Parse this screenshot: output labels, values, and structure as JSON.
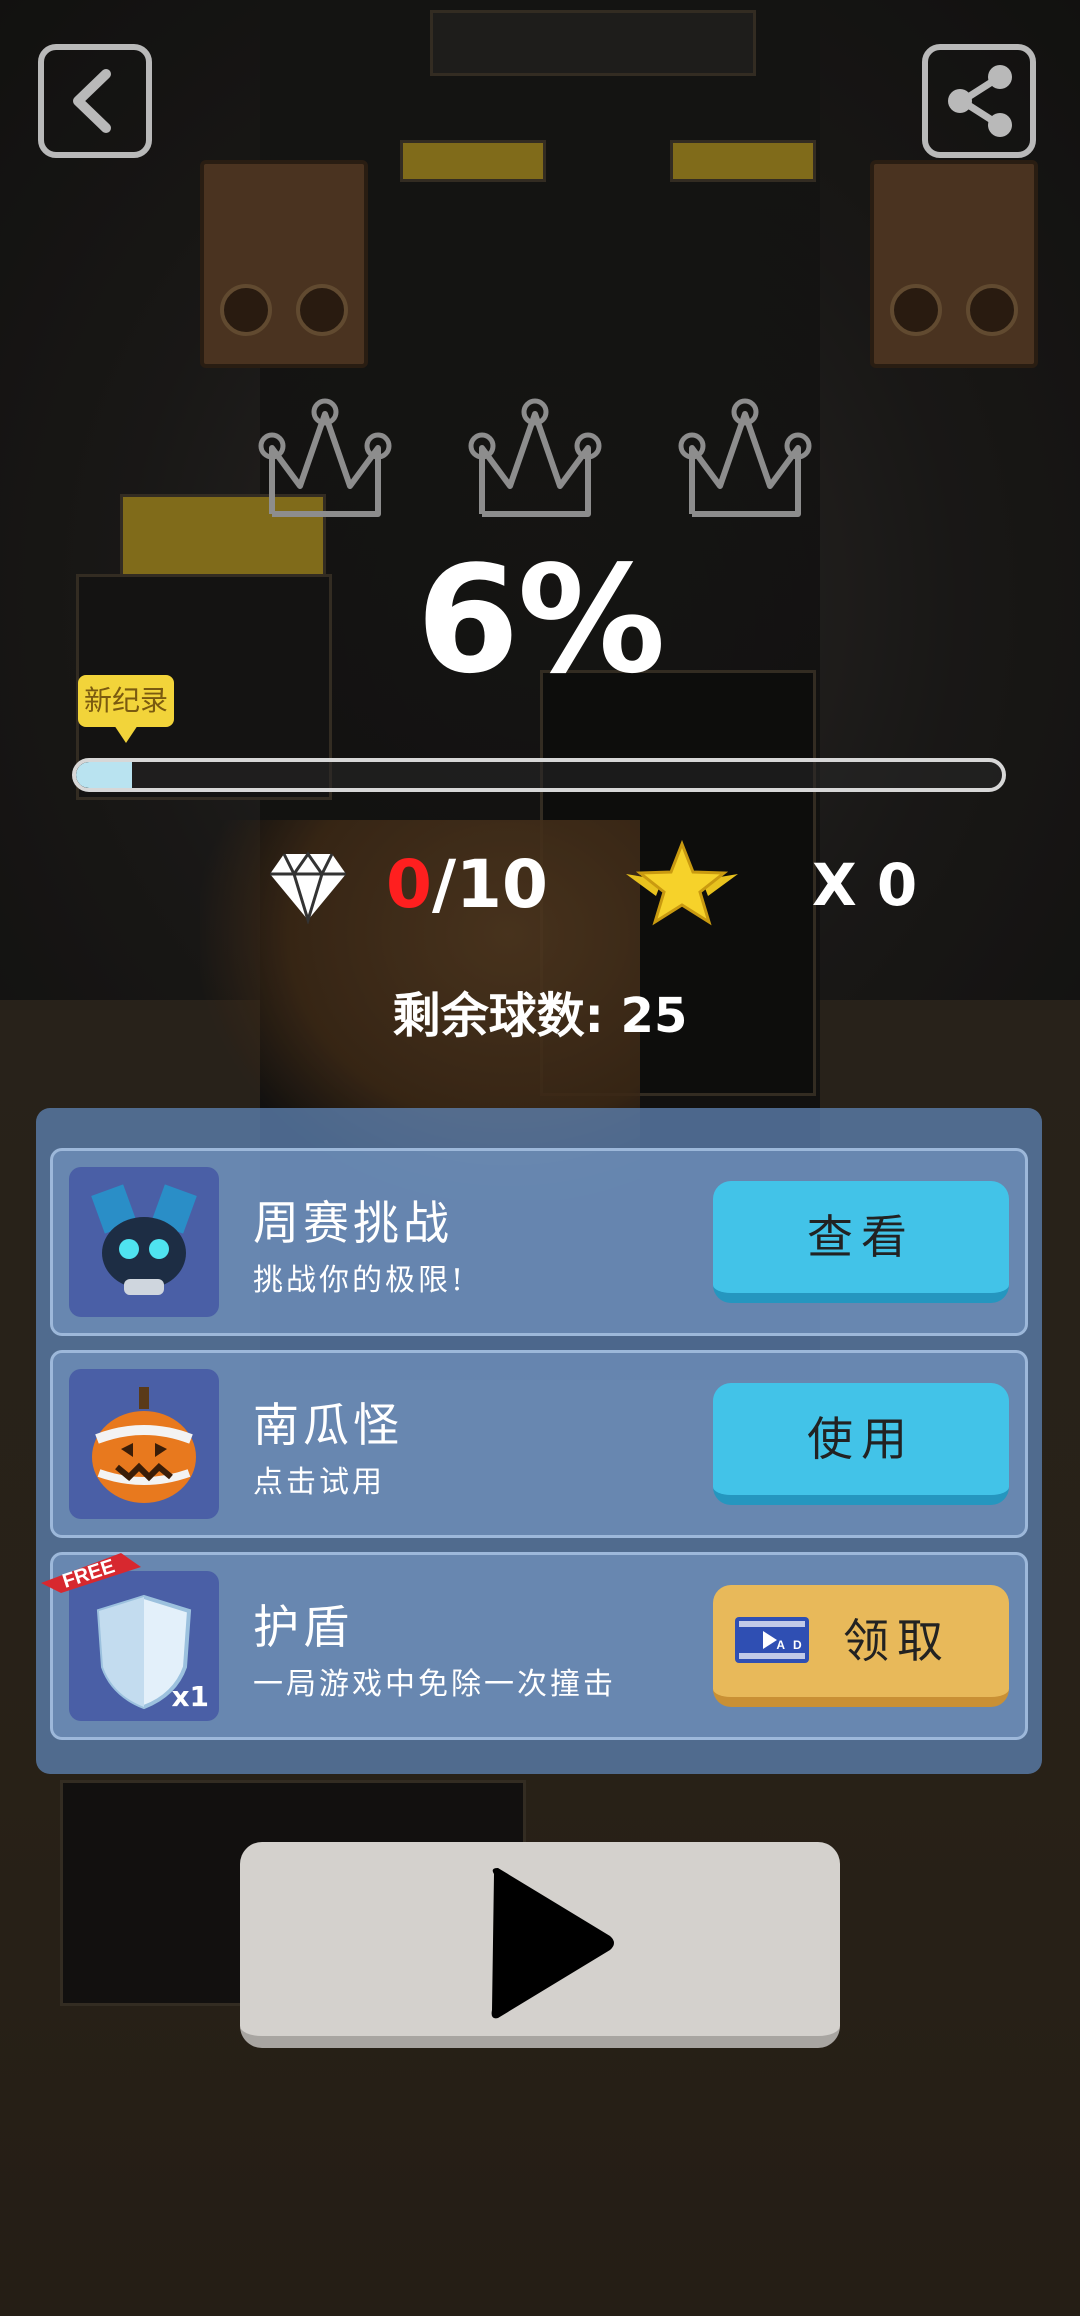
{
  "hud": {
    "back_icon": "chevron-left-icon",
    "share_icon": "share-icon",
    "crowns_earned": 0,
    "crowns_total": 3
  },
  "result": {
    "percent": "6%",
    "progress": 0.06,
    "record_tag": "新纪录"
  },
  "stats": {
    "gems_current": "0",
    "gems_total": "/10",
    "stars": "X 0",
    "balls_label": "剩余球数: 25"
  },
  "offers": [
    {
      "title": "周赛挑战",
      "subtitle": "挑战你的极限!",
      "button": "查看",
      "button_style": "blue",
      "icon": "robot-icon"
    },
    {
      "title": "南瓜怪",
      "subtitle": "点击试用",
      "button": "使用",
      "button_style": "blue",
      "icon": "pumpkin-icon"
    },
    {
      "title": "护盾",
      "subtitle": "一局游戏中免除一次撞击",
      "button": "领取",
      "button_style": "gold",
      "icon": "shield-icon",
      "badge": "FREE",
      "count": "x1",
      "button_icon": "video-ad-icon",
      "button_icon_text": "AD"
    }
  ],
  "play": {
    "icon": "play-icon"
  },
  "colors": {
    "gem_current": "#ff1f1f",
    "blue_button": "#42c3e8",
    "gold_button": "#e8b95a",
    "panel": "#5c80b0"
  }
}
